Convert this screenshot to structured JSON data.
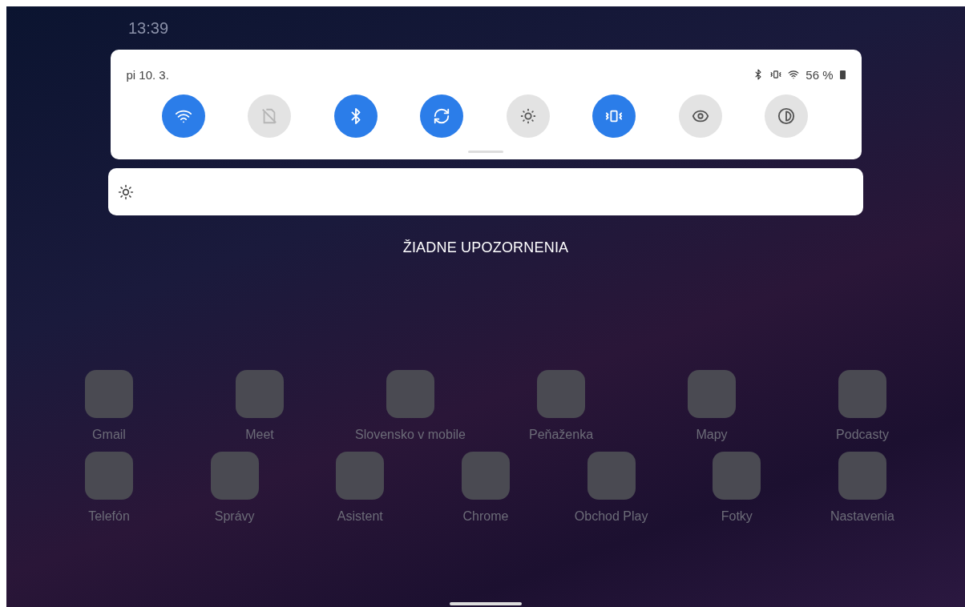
{
  "status_bar": {
    "time": "13:39"
  },
  "quick_settings": {
    "date": "pi 10. 3.",
    "battery": "56 %",
    "tiles": [
      {
        "kind": "wifi",
        "on": true
      },
      {
        "kind": "sim",
        "on": false,
        "disabled": true
      },
      {
        "kind": "bluetooth",
        "on": true
      },
      {
        "kind": "rotate",
        "on": true
      },
      {
        "kind": "brightness",
        "on": false
      },
      {
        "kind": "vibrate",
        "on": true
      },
      {
        "kind": "eye",
        "on": false
      },
      {
        "kind": "contrast",
        "on": false
      }
    ]
  },
  "brightness": {
    "level": 0
  },
  "notifications": {
    "empty_text": "ŽIADNE UPOZORNENIA"
  },
  "apps": [
    {
      "label": "Gmail"
    },
    {
      "label": "Meet"
    },
    {
      "label": "Slovensko v mobile"
    },
    {
      "label": "Peňaženka"
    },
    {
      "label": "Mapy"
    },
    {
      "label": "Podcasty"
    },
    {
      "label": "Telefón"
    },
    {
      "label": "Správy"
    },
    {
      "label": "Asistent"
    },
    {
      "label": "Chrome"
    },
    {
      "label": "Obchod Play"
    },
    {
      "label": "Fotky"
    },
    {
      "label": "Nastavenia"
    }
  ]
}
